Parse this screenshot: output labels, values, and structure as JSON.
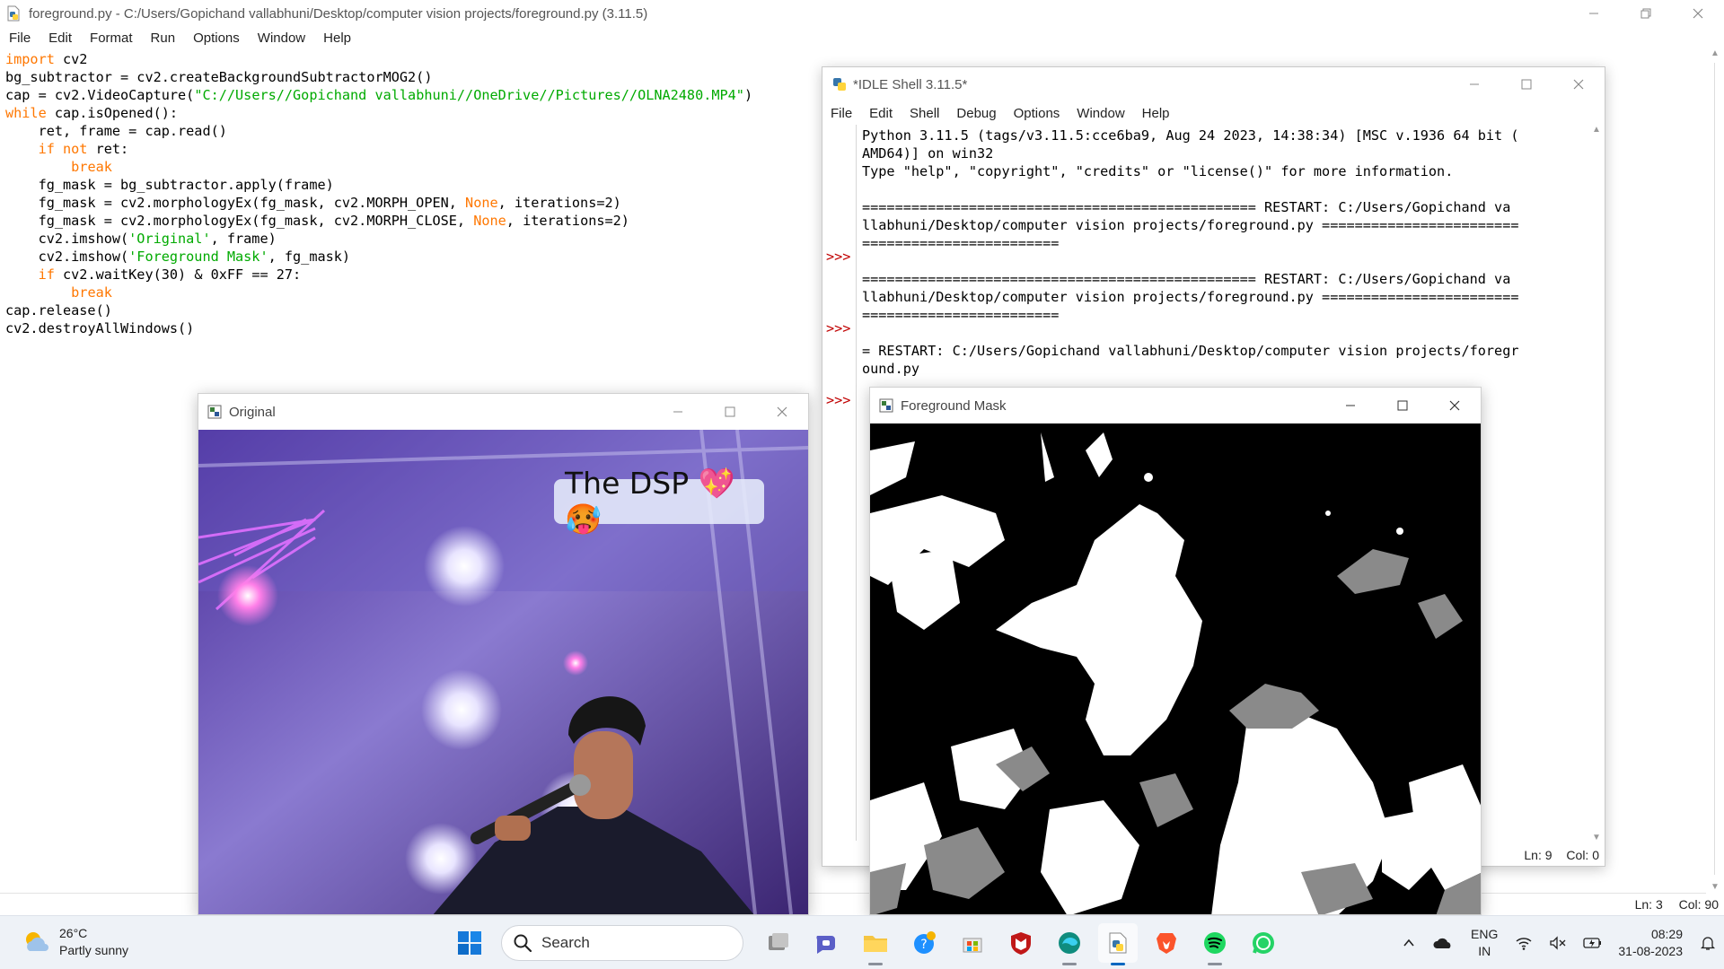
{
  "editor": {
    "title": "foreground.py - C:/Users/Gopichand vallabhuni/Desktop/computer vision projects/foreground.py (3.11.5)",
    "menu": [
      "File",
      "Edit",
      "Format",
      "Run",
      "Options",
      "Window",
      "Help"
    ],
    "code": [
      [
        {
          "t": "import",
          "c": "kw"
        },
        {
          "t": " cv2"
        }
      ],
      [
        {
          "t": "bg_subtractor = cv2.createBackgroundSubtractorMOG2()"
        }
      ],
      [
        {
          "t": "cap = cv2.VideoCapture("
        },
        {
          "t": "\"C://Users//Gopichand vallabhuni//OneDrive//Pictures//OLNA2480.MP4\"",
          "c": "st"
        },
        {
          "t": ")"
        }
      ],
      [
        {
          "t": "while",
          "c": "kw"
        },
        {
          "t": " cap.isOpened():"
        }
      ],
      [
        {
          "t": "    ret, frame = cap.read()"
        }
      ],
      [
        {
          "t": "    "
        },
        {
          "t": "if not",
          "c": "kw"
        },
        {
          "t": " ret:"
        }
      ],
      [
        {
          "t": "        "
        },
        {
          "t": "break",
          "c": "kw"
        }
      ],
      [
        {
          "t": "    fg_mask = bg_subtractor.apply(frame)"
        }
      ],
      [
        {
          "t": "    fg_mask = cv2.morphologyEx(fg_mask, cv2.MORPH_OPEN, "
        },
        {
          "t": "None",
          "c": "kw"
        },
        {
          "t": ", iterations=2)"
        }
      ],
      [
        {
          "t": "    fg_mask = cv2.morphologyEx(fg_mask, cv2.MORPH_CLOSE, "
        },
        {
          "t": "None",
          "c": "kw"
        },
        {
          "t": ", iterations=2)"
        }
      ],
      [
        {
          "t": "    cv2.imshow("
        },
        {
          "t": "'Original'",
          "c": "st"
        },
        {
          "t": ", frame)"
        }
      ],
      [
        {
          "t": "    cv2.imshow("
        },
        {
          "t": "'Foreground Mask'",
          "c": "st"
        },
        {
          "t": ", fg_mask)"
        }
      ],
      [
        {
          "t": "    "
        },
        {
          "t": "if",
          "c": "kw"
        },
        {
          "t": " cv2.waitKey(30) & 0xFF == 27:"
        }
      ],
      [
        {
          "t": "        "
        },
        {
          "t": "break",
          "c": "kw"
        }
      ],
      [
        {
          "t": "cap.release()"
        }
      ],
      [
        {
          "t": "cv2.destroyAllWindows()"
        }
      ]
    ],
    "status": {
      "ln": "Ln: 3",
      "col": "Col: 90"
    }
  },
  "shell": {
    "title": "*IDLE Shell 3.11.5*",
    "menu": [
      "File",
      "Edit",
      "Shell",
      "Debug",
      "Options",
      "Window",
      "Help"
    ],
    "prompt": ">>>",
    "lines": [
      "Python 3.11.5 (tags/v3.11.5:cce6ba9, Aug 24 2023, 14:38:34) [MSC v.1936 64 bit (",
      "AMD64)] on win32",
      "Type \"help\", \"copyright\", \"credits\" or \"license()\" for more information.",
      "",
      "================================================ RESTART: C:/Users/Gopichand va",
      "llabhuni/Desktop/computer vision projects/foreground.py ========================",
      "========================",
      "",
      "================================================ RESTART: C:/Users/Gopichand va",
      "llabhuni/Desktop/computer vision projects/foreground.py ========================",
      "========================",
      "",
      "= RESTART: C:/Users/Gopichand vallabhuni/Desktop/computer vision projects/foregr",
      "ound.py"
    ],
    "status": {
      "ln": "Ln: 9",
      "col": "Col: 0"
    }
  },
  "original_window": {
    "title": "Original",
    "caption": "The DSP 💖🥵"
  },
  "mask_window": {
    "title": "Foreground Mask"
  },
  "taskbar": {
    "weather": {
      "temp": "26°C",
      "desc": "Partly sunny"
    },
    "search_label": "Search",
    "apps": [
      "task-view",
      "teams-chat",
      "file-explorer",
      "get-help",
      "microsoft-store",
      "mcafee",
      "microsoft-edge",
      "idle-python",
      "brave-browser",
      "spotify",
      "whatsapp"
    ],
    "lang": {
      "top": "ENG",
      "bottom": "IN"
    },
    "time": "08:29",
    "date": "31-08-2023"
  },
  "colors": {
    "keyword": "#ff7700",
    "string": "#00aa00",
    "prompt": "#c00000",
    "accent": "#0067c0"
  }
}
